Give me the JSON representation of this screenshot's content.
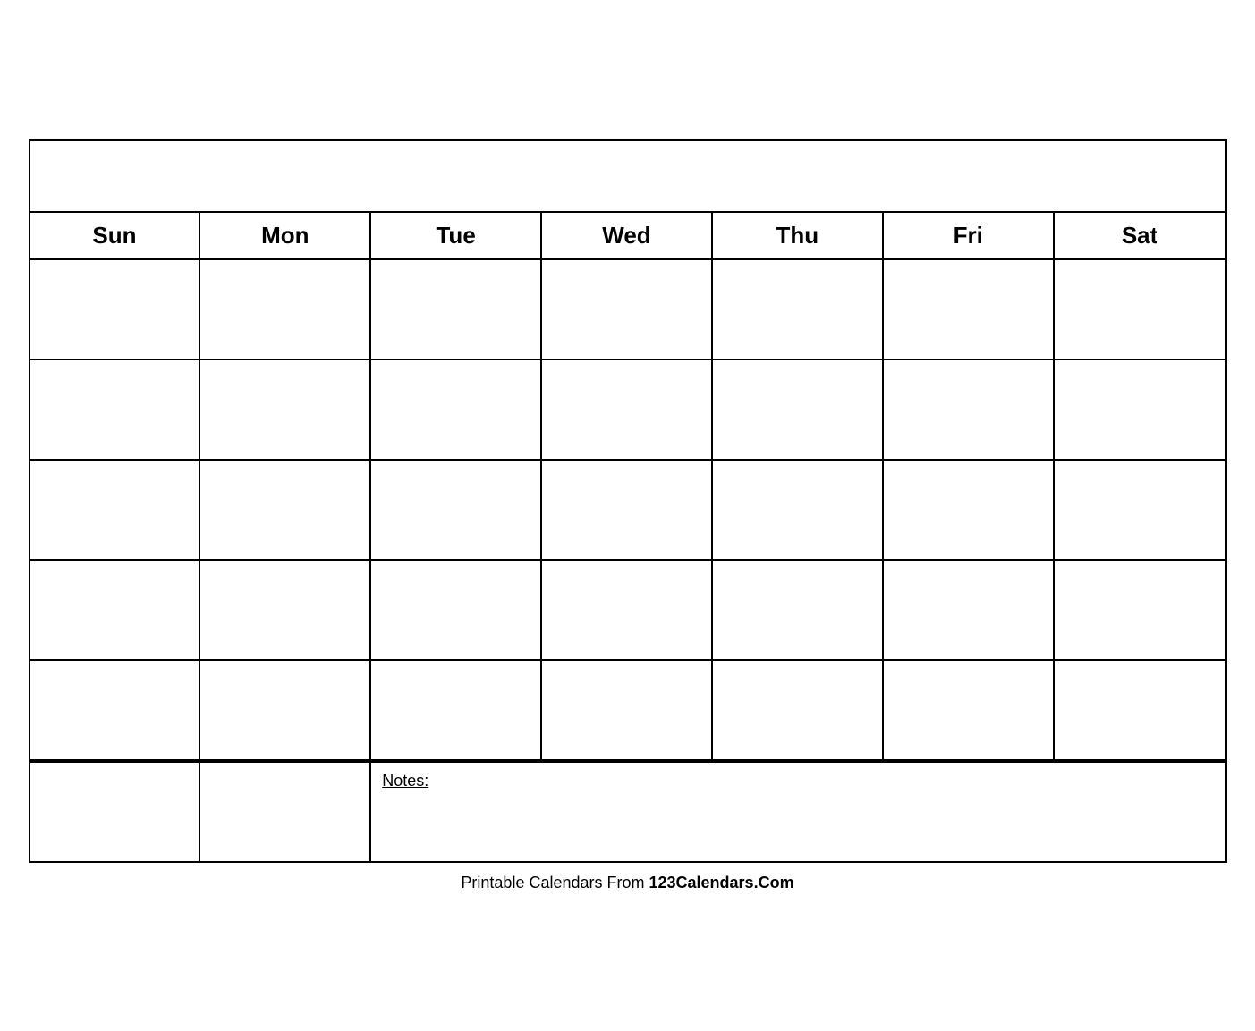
{
  "calendar": {
    "title": "",
    "days": [
      "Sun",
      "Mon",
      "Tue",
      "Wed",
      "Thu",
      "Fri",
      "Sat"
    ],
    "weeks": [
      [
        "",
        "",
        "",
        "",
        "",
        "",
        ""
      ],
      [
        "",
        "",
        "",
        "",
        "",
        "",
        ""
      ],
      [
        "",
        "",
        "",
        "",
        "",
        "",
        ""
      ],
      [
        "",
        "",
        "",
        "",
        "",
        "",
        ""
      ],
      [
        "",
        "",
        "",
        "",
        "",
        "",
        ""
      ]
    ],
    "notes_label": "Notes:",
    "notes_empty_cells": [
      "",
      ""
    ]
  },
  "footer": {
    "text_normal": "Printable Calendars From ",
    "text_bold": "123Calendars.Com"
  }
}
